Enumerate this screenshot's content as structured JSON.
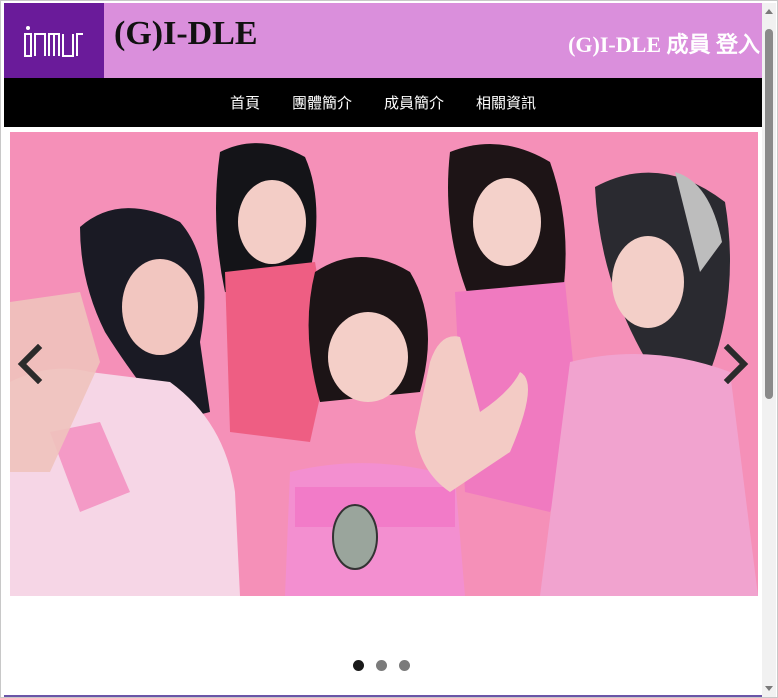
{
  "header": {
    "logo_text": "iʎnʎ",
    "site_title": "(G)I-DLE",
    "member_login": "(G)I-DLE 成員 登入"
  },
  "nav": {
    "items": [
      {
        "label": "首頁"
      },
      {
        "label": "團體簡介"
      },
      {
        "label": "成員簡介"
      },
      {
        "label": "相關資訊"
      }
    ]
  },
  "carousel": {
    "slide_count": 3,
    "active_index": 0
  },
  "colors": {
    "header_bg": "#da8fdc",
    "logo_bg": "#6a1b9a",
    "nav_bg": "#000000",
    "photo_bg": "#f48fb7"
  }
}
